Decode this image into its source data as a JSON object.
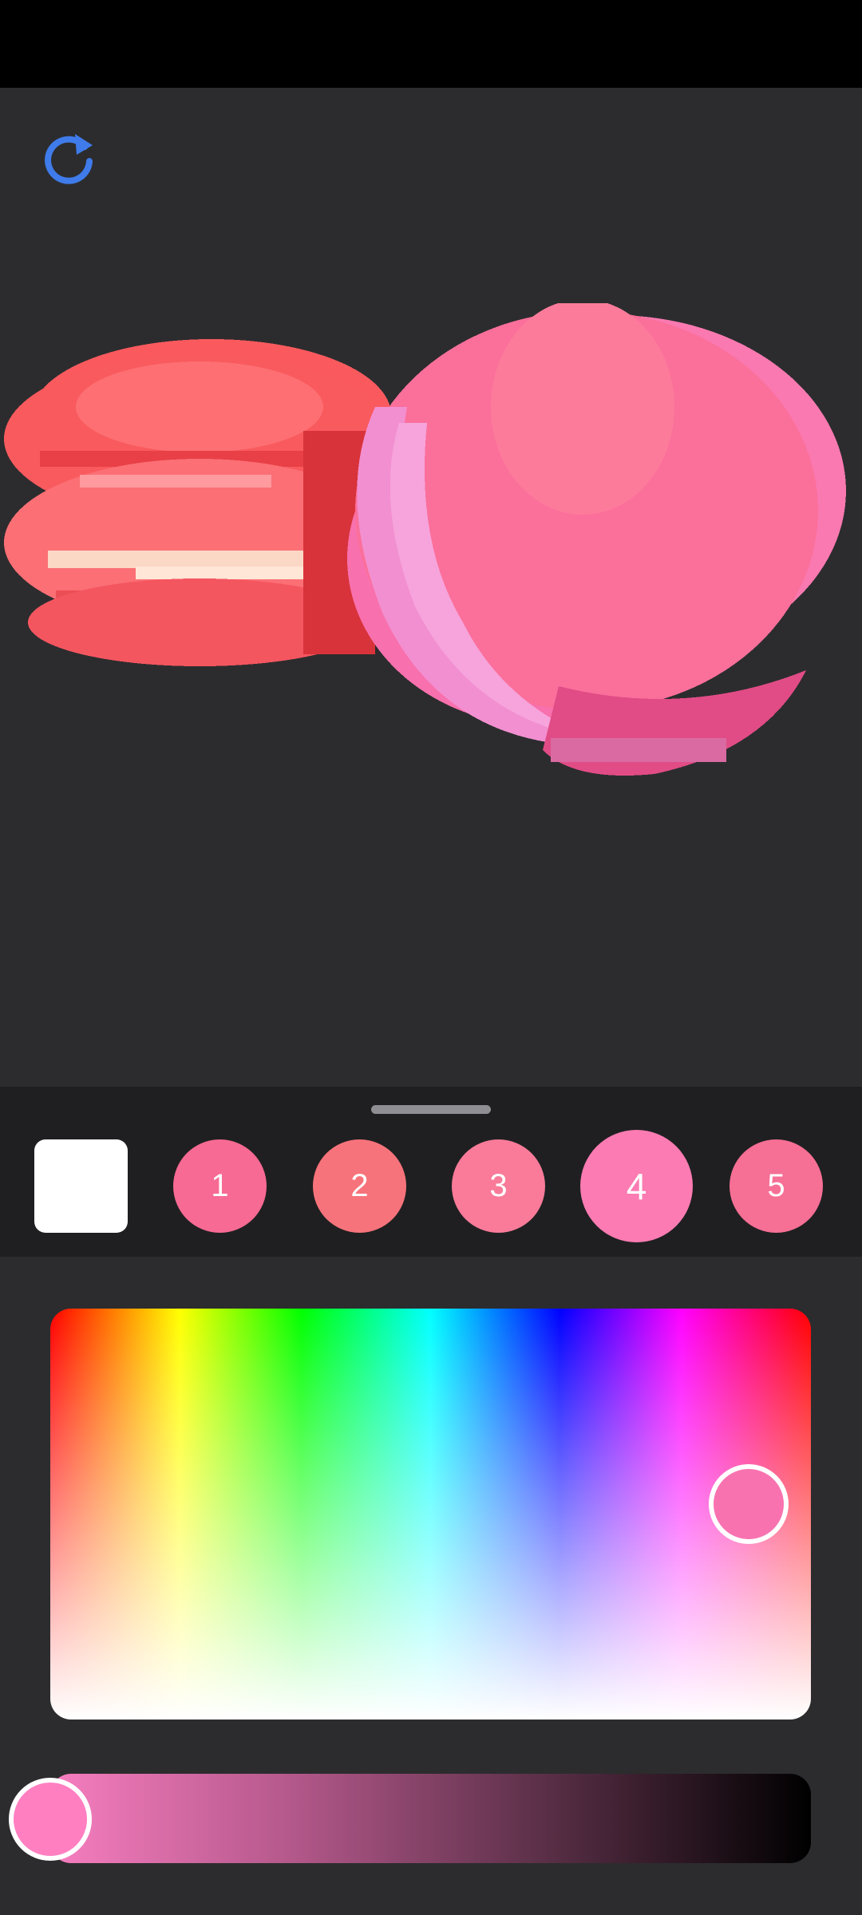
{
  "toolbar": {
    "reset_icon": "refresh-icon"
  },
  "artwork": {
    "subject": "pixel macarons"
  },
  "palette": {
    "items": [
      {
        "label": "",
        "color": "#ffffff"
      },
      {
        "label": "1",
        "color": "#f76a93"
      },
      {
        "label": "2",
        "color": "#f7737b"
      },
      {
        "label": "3",
        "color": "#f97b99"
      },
      {
        "label": "4",
        "color": "#fb7bb2",
        "selected": true
      },
      {
        "label": "5",
        "color": "#f66f95"
      }
    ]
  },
  "color_picker": {
    "current_color": "#f872b0",
    "brightness_thumb_color": "#ff7fc1"
  }
}
